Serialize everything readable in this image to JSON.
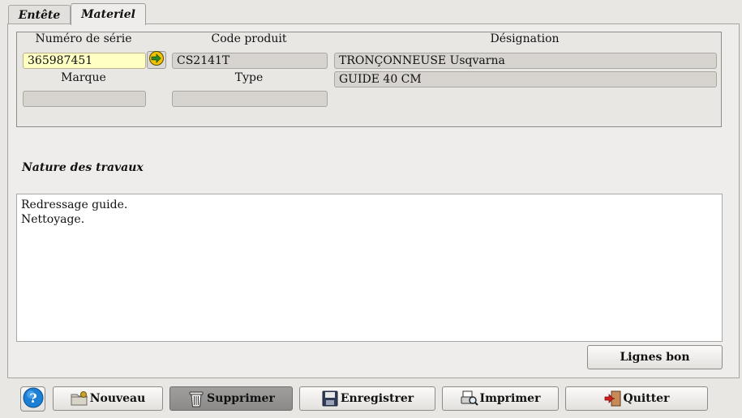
{
  "tabs": [
    {
      "label": "Entête",
      "active": false
    },
    {
      "label": "Materiel",
      "active": true
    }
  ],
  "materiel": {
    "serial_label": "Numéro de série",
    "serial_value": "365987451",
    "product_code_label": "Code produit",
    "product_code_value": "CS2141T",
    "designation_label": "Désignation",
    "designation_line1": "TRONÇONNEUSE Usqvarna",
    "designation_line2": "GUIDE 40 CM",
    "brand_label": "Marque",
    "brand_value": "",
    "type_label": "Type",
    "type_value": ""
  },
  "work": {
    "title": "Nature des travaux",
    "lines": [
      "Redressage guide.",
      "Nettoyage."
    ]
  },
  "buttons": {
    "lignes_bon": "Lignes bon",
    "nouveau": "Nouveau",
    "supprimer": "Supprimer",
    "enregistrer": "Enregistrer",
    "imprimer": "Imprimer",
    "quitter": "Quitter"
  },
  "colors": {
    "input_highlight": "#ffffc4",
    "readonly_field": "#d7d4d0",
    "pressed_button": "#8b8a88",
    "help_blue": "#1b7fd6",
    "arrow_yellow": "#f2c200"
  },
  "icons": {
    "go": "arrow-right-circle-icon",
    "help": "help-icon",
    "nouveau": "new-folder-icon",
    "supprimer": "trash-icon",
    "enregistrer": "floppy-disk-icon",
    "imprimer": "print-preview-icon",
    "quitter": "exit-door-icon"
  }
}
